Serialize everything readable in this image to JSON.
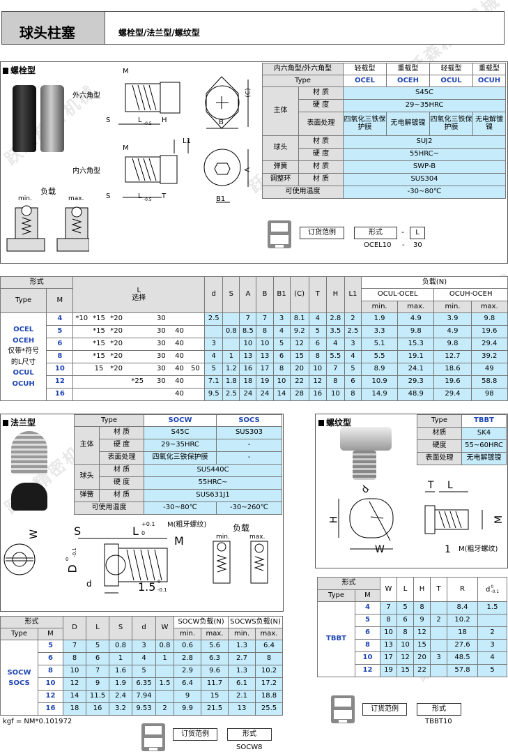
{
  "header": {
    "title": "球头柱塞",
    "subtitle": "螺栓型/法兰型/螺纹型"
  },
  "watermark": "跃森精密机械",
  "bolt": {
    "section": "螺栓型",
    "load_label": "负载",
    "min": "min.",
    "max.": "max.",
    "max": "max.",
    "hex_outer": "外六角型",
    "hex_inner": "内六角型",
    "dim": {
      "M": "M",
      "S": "S",
      "L": "L",
      "L_tol_top": "0",
      "L_tol_bot": "-0.5",
      "H": "H",
      "T": "T",
      "B": "B",
      "B1": "B1",
      "C": "(C)",
      "A": "A",
      "L1": "L1"
    },
    "spec": {
      "h0": "内六角型/外六角型",
      "h1": "轻载型",
      "h2": "重载型",
      "h3": "轻载型",
      "h4": "重载型",
      "type_label": "Type",
      "t1": "OCEL",
      "t2": "OCEH",
      "t3": "OCUL",
      "t4": "OCUH",
      "body": "主体",
      "mat": "材 质",
      "hard": "硬 度",
      "surf": "表面处理",
      "body_mat": "S45C",
      "body_hard": "29~35HRC",
      "surf1": "四氧化三铁保护膜",
      "surf2": "无电解镀镍",
      "surf3": "四氧化三铁保护膜",
      "surf4": "无电解镀镍",
      "ball": "球头",
      "ball_mat": "SUJ2",
      "ball_hard": "55HRC~",
      "spring": "弹簧",
      "spring_mat": "SWP-B",
      "adj": "调整环",
      "adj_mat": "SUS304",
      "temp": "可使用温度",
      "temp_val": "-30~80℃"
    },
    "order": {
      "label": "订货范例",
      "form": "形式",
      "dash": "-",
      "L": "L",
      "ex1": "OCEL10",
      "ex2": "-",
      "ex3": "30"
    }
  },
  "main_table": {
    "h_form": "形式",
    "h_type": "Type",
    "h_M": "M",
    "h_L": "L",
    "h_L2": "选择",
    "cols": [
      "d",
      "S",
      "A",
      "B",
      "B1",
      "(C)",
      "T",
      "H",
      "L1"
    ],
    "h_load": "负载(N)",
    "h_ocul": "OCUL·OCEL",
    "h_ocuh": "OCUH·OCEH",
    "h_min": "min.",
    "h_max": "max.",
    "types": [
      "OCEL",
      "OCEH",
      "仅带*符号",
      "的L尺寸",
      "OCUL",
      "OCUH"
    ],
    "rows": [
      {
        "M": "4",
        "L": [
          "*10",
          "*15",
          "*20",
          "",
          "30",
          "",
          ""
        ],
        "d": "2.5",
        "S": "",
        "A": "7",
        "B": "7",
        "B1": "3",
        "C": "8.1",
        "T": "4",
        "H": "2.8",
        "L1": "2",
        "v": [
          "1.9",
          "4.9",
          "3.9",
          "9.8"
        ]
      },
      {
        "M": "5",
        "L": [
          "",
          "*15",
          "*20",
          "",
          "30",
          "40",
          ""
        ],
        "d": "",
        "S": "0.8",
        "A": "8.5",
        "B": "8",
        "B1": "4",
        "C": "9.2",
        "T": "5",
        "H": "3.5",
        "L1": "2.5",
        "v": [
          "3.3",
          "9.8",
          "4.9",
          "19.6"
        ]
      },
      {
        "M": "6",
        "L": [
          "",
          "*15",
          "*20",
          "",
          "30",
          "40",
          ""
        ],
        "d": "3",
        "S": "",
        "A": "10",
        "B": "10",
        "B1": "5",
        "C": "12",
        "T": "6",
        "H": "4",
        "L1": "3",
        "v": [
          "5.1",
          "15.3",
          "9.8",
          "29.4"
        ]
      },
      {
        "M": "8",
        "L": [
          "",
          "*15",
          "*20",
          "",
          "30",
          "40",
          ""
        ],
        "d": "4",
        "S": "1",
        "A": "13",
        "B": "13",
        "B1": "6",
        "C": "15",
        "T": "8",
        "H": "5.5",
        "L1": "4",
        "v": [
          "5.5",
          "19.1",
          "12.7",
          "39.2"
        ]
      },
      {
        "M": "10",
        "L": [
          "",
          "15",
          "*20",
          "",
          "30",
          "40",
          "50"
        ],
        "d": "5",
        "S": "1.2",
        "A": "16",
        "B": "17",
        "B1": "8",
        "C": "20",
        "T": "10",
        "H": "7",
        "L1": "5",
        "v": [
          "8.9",
          "24.1",
          "18.6",
          "49"
        ]
      },
      {
        "M": "12",
        "L": [
          "",
          "",
          "",
          "*25",
          "30",
          "40",
          ""
        ],
        "d": "7.1",
        "S": "1.8",
        "A": "18",
        "B": "19",
        "B1": "10",
        "C": "22",
        "T": "12",
        "H": "8",
        "L1": "6",
        "v": [
          "10.9",
          "29.3",
          "19.6",
          "58.8"
        ]
      },
      {
        "M": "16",
        "L": [
          "",
          "",
          "",
          "",
          "",
          "40",
          ""
        ],
        "d": "9.5",
        "S": "2.5",
        "A": "24",
        "B": "24",
        "B1": "14",
        "C": "28",
        "T": "16",
        "H": "10",
        "L1": "8",
        "v": [
          "14.9",
          "48.9",
          "29.4",
          "98"
        ]
      }
    ]
  },
  "flange": {
    "section": "法兰型",
    "spec": {
      "type": "Type",
      "t1": "SOCW",
      "t2": "SOCS",
      "body": "主体",
      "mat": "材 质",
      "hard": "硬 度",
      "surf": "表面处理",
      "m1": "S45C",
      "m2": "SUS303",
      "h1": "29~35HRC",
      "h2": "-",
      "s1": "四氧化三铁保护膜",
      "s2": "-",
      "ball": "球头",
      "bm": "SUS440C",
      "bh": "55HRC~",
      "spring": "弹簧",
      "sm": "SUS631J1",
      "temp": "可使用温度",
      "tp1": "-30~80℃",
      "tp2": "-30~260℃"
    },
    "dim": {
      "W": "W",
      "S": "S",
      "L": "L",
      "L_tol_top": "+0.1",
      "L_tol_bot": "0",
      "M": "M",
      "M_note": "M(粗牙螺纹)",
      "D": "D",
      "D_tol_top": "0",
      "D_tol_bot": "-0.1",
      "d": "d",
      "t": "1.5",
      "t_tol_top": "0",
      "t_tol_bot": "-0.1",
      "load": "负载",
      "min": "min.",
      "max": "max."
    },
    "table": {
      "h_form": "形式",
      "h_type": "Type",
      "h_M": "M",
      "cols": [
        "D",
        "L",
        "S",
        "d",
        "W"
      ],
      "h_socw": "SOCW负载(N)",
      "h_socs": "SOCWS负载(N)",
      "min": "min.",
      "max": "max.",
      "types": [
        "SOCW",
        "SOCS"
      ],
      "rows": [
        {
          "M": "5",
          "D": "7",
          "L": "5",
          "S": "0.8",
          "d": "3",
          "W": "0.8",
          "v": [
            "0.6",
            "5.6",
            "1.3",
            "6.4"
          ]
        },
        {
          "M": "6",
          "D": "8",
          "L": "6",
          "S": "1",
          "d": "4",
          "W": "1",
          "v": [
            "2.8",
            "6.3",
            "2.7",
            "8"
          ]
        },
        {
          "M": "8",
          "D": "10",
          "L": "7",
          "S": "1.6",
          "d": "5",
          "W": "",
          "v": [
            "2.9",
            "9.6",
            "1.3",
            "10.2"
          ]
        },
        {
          "M": "10",
          "D": "12",
          "L": "9",
          "S": "1.9",
          "d": "6.35",
          "W": "1.5",
          "v": [
            "6.4",
            "11.7",
            "6.1",
            "17.2"
          ]
        },
        {
          "M": "12",
          "D": "14",
          "L": "11.5",
          "S": "2.4",
          "d": "7.94",
          "W": "",
          "v": [
            "9",
            "15",
            "2.1",
            "18.8"
          ]
        },
        {
          "M": "16",
          "D": "18",
          "L": "16",
          "S": "3.2",
          "d": "9.53",
          "W": "2",
          "v": [
            "9.9",
            "21.5",
            "13",
            "25.5"
          ]
        }
      ]
    },
    "note": "kgf = NM*0.101972",
    "order": {
      "label": "订货范例",
      "form": "形式",
      "ex": "SOCW8"
    }
  },
  "thread": {
    "section": "螺纹型",
    "spec": {
      "type": "Type",
      "t": "TBBT",
      "mat": "材质",
      "m": "SK4",
      "hard": "硬度",
      "h": "55~60HRC",
      "surf": "表面处理",
      "s": "无电解镀镍"
    },
    "dim": {
      "d": "d",
      "T": "T",
      "L": "L",
      "H": "H",
      "M": "M",
      "W": "W",
      "one": "1",
      "note": "M(粗牙螺纹)"
    },
    "table": {
      "h_form": "形式",
      "h_type": "Type",
      "h_M": "M",
      "cols": [
        "W",
        "L",
        "H",
        "T",
        "R"
      ],
      "h_d": "d",
      "d_tol_top": "0",
      "d_tol_bot": "-0.1",
      "type": "TBBT",
      "rows": [
        {
          "M": "4",
          "W": "7",
          "L": "5",
          "H": "8",
          "T": "",
          "R": "8.4",
          "d": "1.5"
        },
        {
          "M": "5",
          "W": "8",
          "L": "6",
          "H": "9",
          "T": "2",
          "R": "10.2",
          "d": ""
        },
        {
          "M": "6",
          "W": "10",
          "L": "8",
          "H": "12",
          "T": "",
          "R": "18",
          "d": "2"
        },
        {
          "M": "8",
          "W": "13",
          "L": "10",
          "H": "15",
          "T": "",
          "R": "27.6",
          "d": "3"
        },
        {
          "M": "10",
          "W": "17",
          "L": "12",
          "H": "20",
          "T": "3",
          "R": "48.5",
          "d": "4"
        },
        {
          "M": "12",
          "W": "19",
          "L": "15",
          "H": "22",
          "T": "",
          "R": "57.8",
          "d": "5"
        }
      ]
    },
    "order": {
      "label": "订货范例",
      "form": "形式",
      "ex": "TBBT10"
    }
  },
  "colors": {
    "accent": "#1f46b4",
    "cell_blue": "#c6ecfb",
    "header_gray": "#e0e0e0"
  }
}
